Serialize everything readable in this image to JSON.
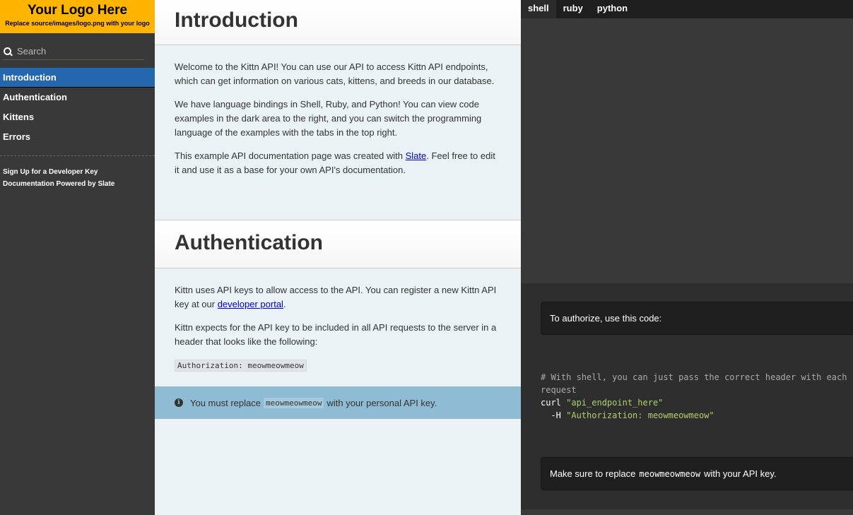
{
  "sidebar": {
    "logo_title": "Your Logo Here",
    "logo_subtitle": "Replace source/images/logo.png with your logo",
    "search_placeholder": "Search",
    "toc": [
      {
        "label": "Introduction",
        "active": true
      },
      {
        "label": "Authentication",
        "active": false
      },
      {
        "label": "Kittens",
        "active": false
      },
      {
        "label": "Errors",
        "active": false
      }
    ],
    "footer_links": [
      "Sign Up for a Developer Key",
      "Documentation Powered by Slate"
    ]
  },
  "intro": {
    "title": "Introduction",
    "p1": "Welcome to the Kittn API! You can use our API to access Kittn API endpoints, which can get information on various cats, kittens, and breeds in our database.",
    "p2": "We have language bindings in Shell, Ruby, and Python! You can view code examples in the dark area to the right, and you can switch the programming language of the examples with the tabs in the top right.",
    "p3_before": "This example API documentation page was created with ",
    "p3_link": "Slate",
    "p3_after": ". Feel free to edit it and use it as a base for your own API's documentation."
  },
  "auth": {
    "title": "Authentication",
    "p1_before": "Kittn uses API keys to allow access to the API. You can register a new Kittn API key at our ",
    "p1_link": "developer portal",
    "p1_after": ".",
    "p2": "Kittn expects for the API key to be included in all API requests to the server in a header that looks like the following:",
    "code": "Authorization: meowmeowmeow",
    "notice_before": "You must replace ",
    "notice_code": "meowmeowmeow",
    "notice_after": " with your personal API key."
  },
  "code_panel": {
    "tabs": [
      "shell",
      "ruby",
      "python"
    ],
    "active_tab": "shell",
    "aside1": "To authorize, use this code:",
    "comment_line1": "# With shell, you can just pass the correct header with each",
    "comment_line2": "request",
    "curl_cmd": "curl ",
    "curl_arg": "\"api_endpoint_here\"",
    "flag": "  -H ",
    "flag_arg": "\"Authorization: meowmeowmeow\"",
    "aside2_before": "Make sure to replace ",
    "aside2_code": "meowmeowmeow",
    "aside2_after": " with your API key."
  },
  "colors": {
    "logo_bg": "#ffb400",
    "active_nav": "#2467af",
    "notice_bg": "#8fbcd4",
    "code_string": "#b0d06a"
  }
}
